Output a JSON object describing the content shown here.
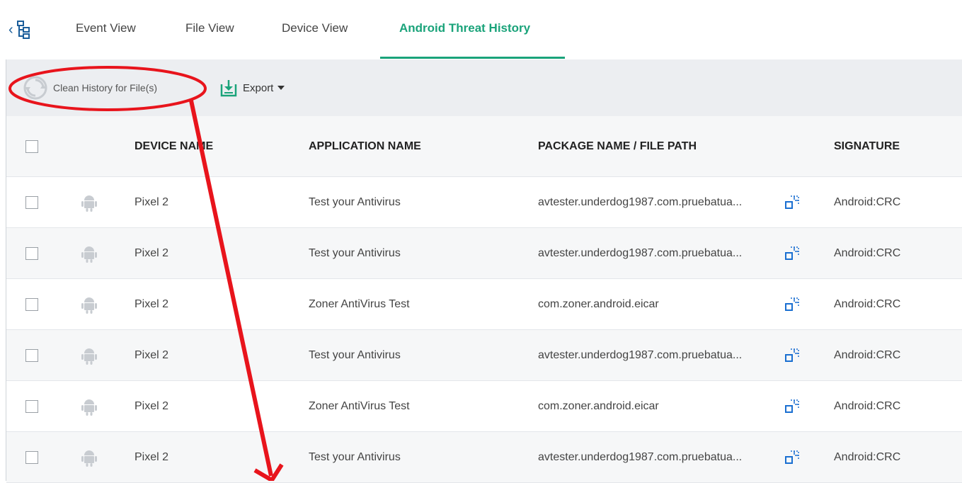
{
  "tabs": [
    {
      "label": "Event View",
      "active": false
    },
    {
      "label": "File View",
      "active": false
    },
    {
      "label": "Device View",
      "active": false
    },
    {
      "label": "Android Threat History",
      "active": true
    }
  ],
  "toolbar": {
    "clean_label": "Clean History for File(s)",
    "export_label": "Export"
  },
  "table": {
    "columns": [
      "DEVICE NAME",
      "APPLICATION NAME",
      "PACKAGE NAME / FILE PATH",
      "SIGNATURE"
    ],
    "rows": [
      {
        "device": "Pixel 2",
        "application": "Test your Antivirus",
        "package": "avtester.underdog1987.com.pruebatua...",
        "signature": "Android:CRC"
      },
      {
        "device": "Pixel 2",
        "application": "Test your Antivirus",
        "package": "avtester.underdog1987.com.pruebatua...",
        "signature": "Android:CRC"
      },
      {
        "device": "Pixel 2",
        "application": "Zoner AntiVirus Test",
        "package": "com.zoner.android.eicar",
        "signature": "Android:CRC"
      },
      {
        "device": "Pixel 2",
        "application": "Test your Antivirus",
        "package": "avtester.underdog1987.com.pruebatua...",
        "signature": "Android:CRC"
      },
      {
        "device": "Pixel 2",
        "application": "Zoner AntiVirus Test",
        "package": "com.zoner.android.eicar",
        "signature": "Android:CRC"
      },
      {
        "device": "Pixel 2",
        "application": "Test your Antivirus",
        "package": "avtester.underdog1987.com.pruebatua...",
        "signature": "Android:CRC"
      }
    ]
  },
  "icons": {
    "tree": "tree-structure-icon",
    "back": "chevron-left-icon",
    "clean": "clean-history-icon",
    "export": "export-download-icon",
    "device": "android-icon",
    "popup": "open-popup-icon"
  },
  "colors": {
    "accent": "#1aa37a",
    "link_blue": "#1a5d9a",
    "annotation_red": "#e8141c",
    "toolbar_bg": "#eceef1"
  }
}
